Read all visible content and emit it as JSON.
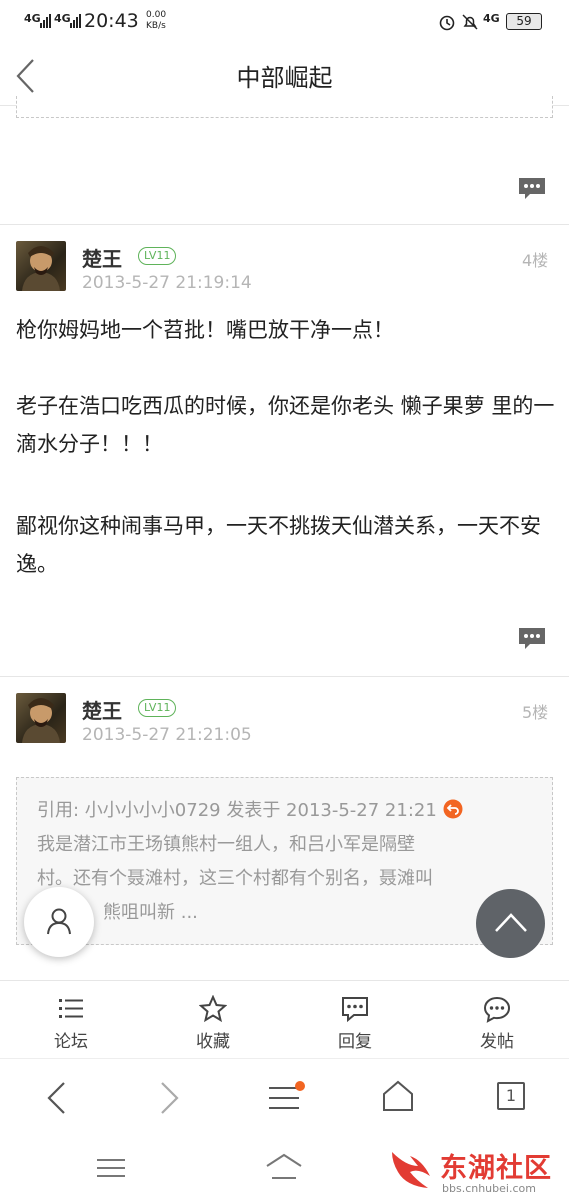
{
  "status": {
    "signal1": "4G",
    "signal2": "4G",
    "time": "20:43",
    "speed_top": "0.00",
    "speed_bottom": "KB/s",
    "net": "4G",
    "battery": "59"
  },
  "header": {
    "title": "中部崛起"
  },
  "posts": [
    {
      "username": "楚王",
      "level": "LV11",
      "time": "2013-5-27 21:19:14",
      "floor": "4楼",
      "paragraphs": [
        "枪你姆妈地一个苕批！嘴巴放干净一点！",
        "老子在浩口吃西瓜的时候，你还是你老头 懒子果萝 里的一滴水分子！！！",
        "鄙视你这种闹事马甲，一天不挑拨天仙潜关系，一天不安逸。"
      ]
    },
    {
      "username": "楚王",
      "level": "LV11",
      "time": "2013-5-27 21:21:05",
      "floor": "5楼",
      "quote": {
        "head": "引用: 小小小小小0729 发表于 2013-5-27 21:21",
        "line1": "我是潜江市王场镇熊村一组人，和吕小军是隔壁",
        "line2": "村。还有个聂滩村，这三个村都有个别名，聂滩叫",
        "line3": "熊咀叫新 ..."
      }
    }
  ],
  "bottom_tabs": [
    {
      "label": "论坛",
      "icon": "list-icon"
    },
    {
      "label": "收藏",
      "icon": "star-icon"
    },
    {
      "label": "回复",
      "icon": "reply-icon"
    },
    {
      "label": "发帖",
      "icon": "post-icon"
    }
  ],
  "browser": {
    "tab_count": "1"
  },
  "watermark": {
    "brand": "东湖社区",
    "url": "bbs.cnhubei.com"
  },
  "colors": {
    "accent": "#f26522",
    "level_green": "#5fb35a",
    "muted": "#b5b5b5",
    "scroll_top_bg": "#5f6368"
  }
}
